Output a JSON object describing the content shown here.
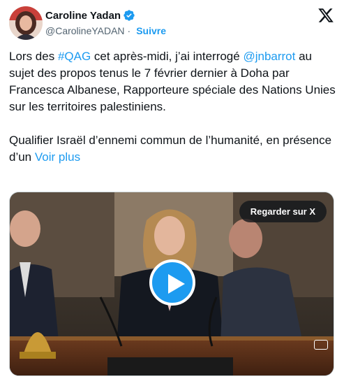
{
  "author": {
    "name": "Caroline Yadan",
    "handle": "@CarolineYADAN",
    "separator": "·",
    "follow_label": "Suivre",
    "verified_color": "#1d9bf0"
  },
  "icons": {
    "brand": "x-logo-icon",
    "verified": "verified-badge-icon",
    "play": "play-icon"
  },
  "tweet": {
    "para1": [
      {
        "text": "Lors des ",
        "link": false
      },
      {
        "text": "#QAG",
        "link": true
      },
      {
        "text": " cet après-midi, j’ai interrogé ",
        "link": false
      },
      {
        "text": "@jnbarrot",
        "link": true
      },
      {
        "text": " au sujet des propos tenus le 7 février dernier à Doha par Francesca Albanese, Rapporteure spéciale des Nations Unies sur les territoires palestiniens.",
        "link": false
      }
    ],
    "para2_text": "Qualifier Israël d’ennemi commun de l’humanité, en présence d’un ",
    "see_more": "Voir plus"
  },
  "media": {
    "watch_label": "Regarder sur X"
  },
  "colors": {
    "accent": "#1d9bf0",
    "text": "#0f1419",
    "secondary": "#536471"
  }
}
